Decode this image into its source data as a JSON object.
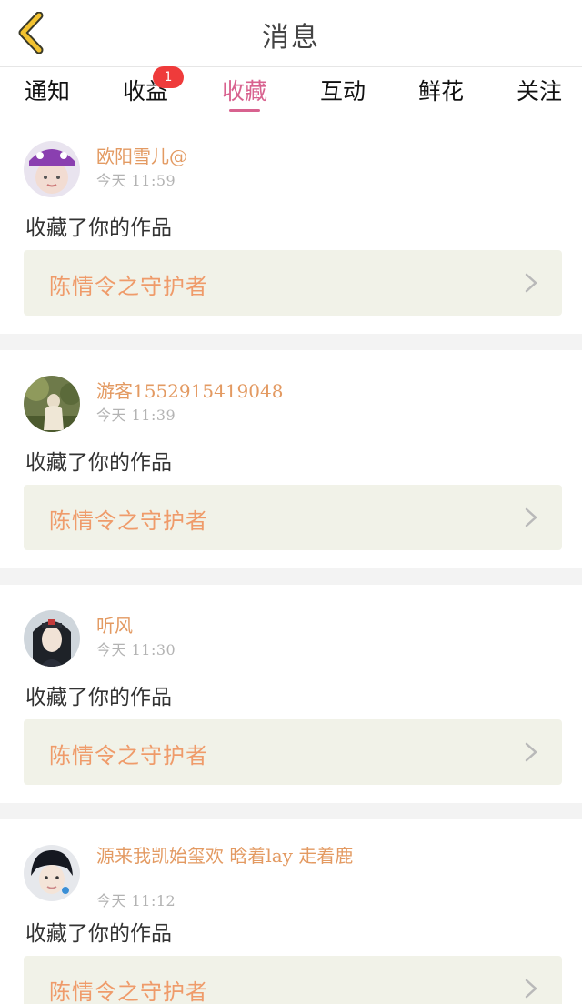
{
  "header": {
    "title": "消息"
  },
  "tabs": [
    {
      "label": "通知",
      "active": false
    },
    {
      "label": "收益",
      "active": false,
      "badge": "1"
    },
    {
      "label": "收藏",
      "active": true
    },
    {
      "label": "互动",
      "active": false
    },
    {
      "label": "鲜花",
      "active": false
    },
    {
      "label": "关注",
      "active": false
    }
  ],
  "feed": [
    {
      "username": "欧阳雪儿@",
      "time": "今天  11:59",
      "action": "收藏了你的作品",
      "work_title": "陈情令之守护者",
      "avatar": "avatar-girl-hat"
    },
    {
      "username": "游客1552915419048",
      "time": "今天  11:39",
      "action": "收藏了你的作品",
      "work_title": "陈情令之守护者",
      "avatar": "avatar-outdoor-figure"
    },
    {
      "username": "听风",
      "time": "今天  11:30",
      "action": "收藏了你的作品",
      "work_title": "陈情令之守护者",
      "avatar": "avatar-costume-man"
    },
    {
      "username": "源来我凯始玺欢 晗着lay 走着鹿",
      "time": "今天  11:12",
      "action": "收藏了你的作品",
      "work_title": "陈情令之守护者",
      "avatar": "avatar-boy"
    }
  ],
  "colors": {
    "accent": "#d8628f",
    "username": "#e39a62",
    "work_title": "#ef9b6a",
    "work_box_bg": "#f1f2e8",
    "badge": "#ef3b3b",
    "back_arrow": "#f2c230"
  }
}
